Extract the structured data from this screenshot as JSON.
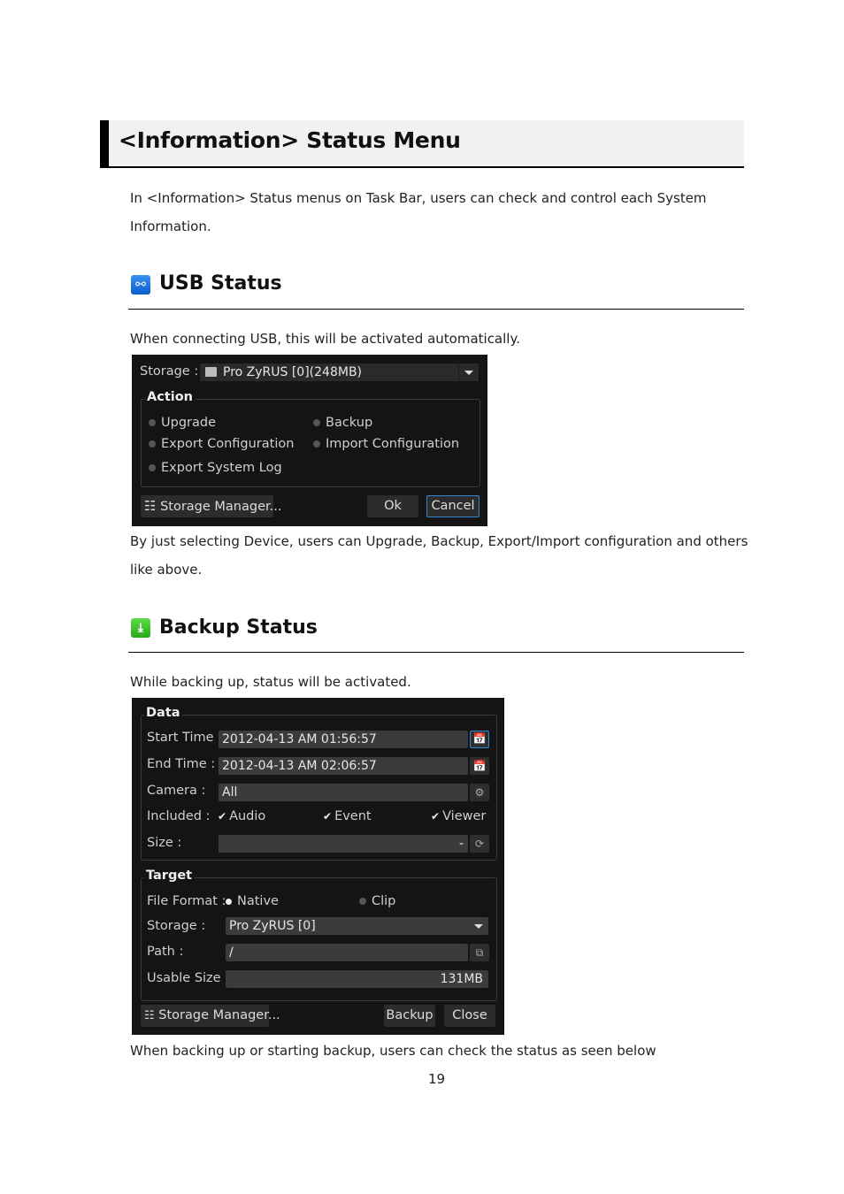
{
  "page": {
    "title": "<Information> Status Menu",
    "intro_line1": "In <Information> Status menus on Task Bar, users can check and control each System",
    "intro_line2": "Information.",
    "page_number": "19"
  },
  "usb_section": {
    "heading": "USB Status",
    "icon": "usb-icon",
    "description": "When connecting USB, this will be activated automatically.",
    "after_line1": "By just selecting Device, users can Upgrade, Backup, Export/Import configuration and others",
    "after_line2": "like above.",
    "dialog": {
      "storage_label": "Storage :",
      "storage_value": "Pro ZyRUS [0](248MB)",
      "action_group_title": "Action",
      "actions": [
        {
          "label": "Upgrade",
          "selected": false
        },
        {
          "label": "Backup",
          "selected": false
        },
        {
          "label": "Export Configuration",
          "selected": false
        },
        {
          "label": "Import Configuration",
          "selected": false
        },
        {
          "label": "Export System Log",
          "selected": false
        }
      ],
      "storage_manager_label": "Storage Manager...",
      "ok_label": "Ok",
      "cancel_label": "Cancel"
    }
  },
  "backup_section": {
    "heading": "Backup Status",
    "icon": "backup-download-icon",
    "description": "While backing up, status will be activated.",
    "after_line": "When backing up or starting backup, users can check the status as seen below",
    "dialog": {
      "data_group_title": "Data",
      "start_time_label": "Start Time :",
      "start_time_value": "2012-04-13 AM 01:56:57",
      "end_time_label": "End Time :",
      "end_time_value": "2012-04-13 AM 02:06:57",
      "camera_label": "Camera :",
      "camera_value": "All",
      "included_label": "Included :",
      "included": [
        {
          "label": "Audio",
          "checked": true
        },
        {
          "label": "Event",
          "checked": true
        },
        {
          "label": "Viewer",
          "checked": true
        }
      ],
      "size_label": "Size :",
      "size_value": "-",
      "target_group_title": "Target",
      "file_format_label": "File Format :",
      "file_format_options": [
        {
          "label": "Native",
          "selected": true
        },
        {
          "label": "Clip",
          "selected": false
        }
      ],
      "storage_label": "Storage :",
      "storage_value": "Pro ZyRUS [0]",
      "path_label": "Path :",
      "path_value": "/",
      "usable_size_label": "Usable Size :",
      "usable_size_value": "131MB",
      "storage_manager_label": "Storage Manager...",
      "backup_label": "Backup",
      "close_label": "Close"
    }
  },
  "colors": {
    "dialog_bg": "#141414",
    "field_bg": "#3b3b3b",
    "focus_border": "#2f86d6",
    "usb_icon": "#1a6fdc",
    "backup_icon": "#3cc22c"
  }
}
